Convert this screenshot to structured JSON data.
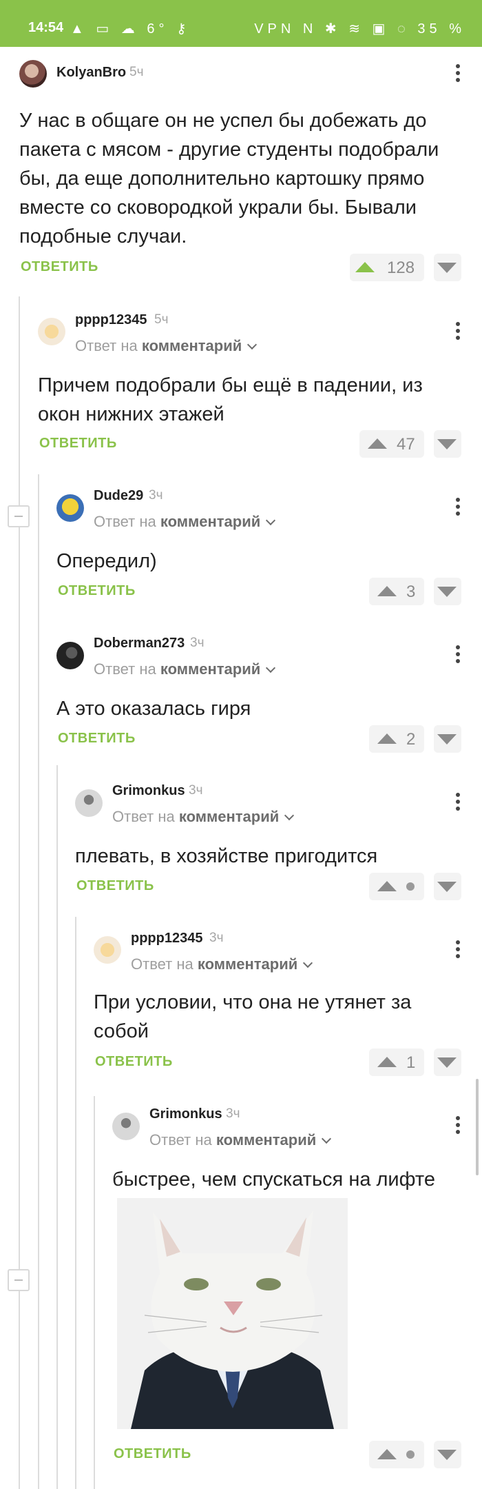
{
  "status_bar": {
    "time": "14:54",
    "left_icons": "▲ ▭ ☁ 6° ⚷",
    "right_icons": "VPN N ✱ ≋ ▣ ◌ 35 %"
  },
  "comments": [
    {
      "username": "KolyanBro",
      "time": "5ч",
      "text": "У нас в общаге он не успел бы добежать до пакета с мясом - другие студенты подобрали бы, да еще дополнительно картошку прямо вместе со сковородкой украли бы. Бывали подобные случаи.",
      "reply_label": "ОТВЕТИТЬ",
      "score": "128"
    },
    {
      "username": "pppp12345",
      "time": "5ч",
      "reply_prefix": "Ответ на",
      "reply_target": "комментарий",
      "text": "Причем подобрали бы ещё в падении, из окон нижних этажей",
      "reply_label": "ОТВЕТИТЬ",
      "score": "47"
    },
    {
      "username": "Dude29",
      "time": "3ч",
      "reply_prefix": "Ответ на",
      "reply_target": "комментарий",
      "text": "Опередил)",
      "reply_label": "ОТВЕТИТЬ",
      "score": "3"
    },
    {
      "username": "Doberman273",
      "time": "3ч",
      "reply_prefix": "Ответ на",
      "reply_target": "комментарий",
      "text": "А это оказалась гиря",
      "reply_label": "ОТВЕТИТЬ",
      "score": "2"
    },
    {
      "username": "Grimonkus",
      "time": "3ч",
      "reply_prefix": "Ответ на",
      "reply_target": "комментарий",
      "text": "плевать, в хозяйстве пригодится",
      "reply_label": "ОТВЕТИТЬ",
      "score": ""
    },
    {
      "username": "pppp12345",
      "time": "3ч",
      "reply_prefix": "Ответ на",
      "reply_target": "комментарий",
      "text": "При условии, что она не утянет за собой",
      "reply_label": "ОТВЕТИТЬ",
      "score": "1"
    },
    {
      "username": "Grimonkus",
      "time": "3ч",
      "reply_prefix": "Ответ на",
      "reply_target": "комментарий",
      "text": "быстрее, чем спускаться на лифте",
      "reply_label": "ОТВЕТИТЬ",
      "score": ""
    }
  ],
  "colors": {
    "accent": "#8ac24a",
    "status_bar": "#8ac24a",
    "muted": "#9e9e9e"
  }
}
